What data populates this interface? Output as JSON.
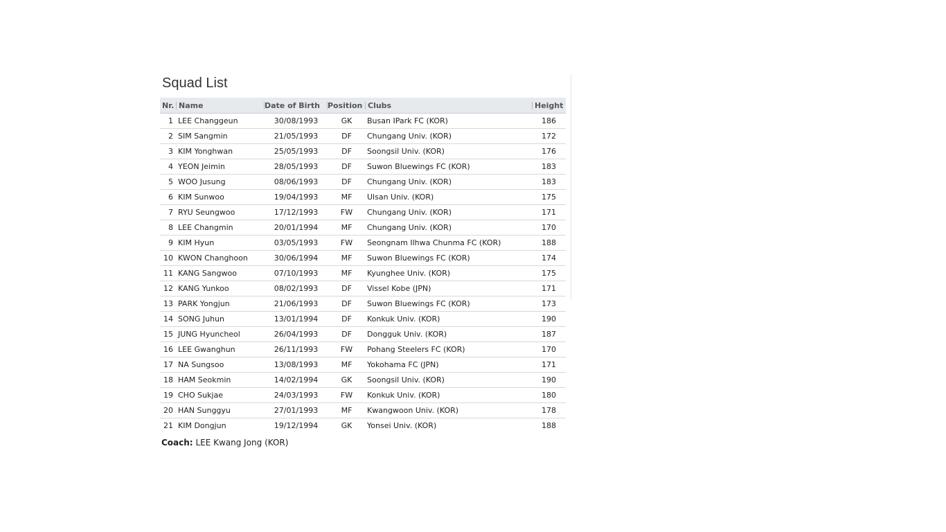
{
  "title": "Squad List",
  "columns": {
    "nr": "Nr.",
    "name": "Name",
    "dob": "Date of Birth",
    "position": "Position",
    "clubs": "Clubs",
    "height": "Height"
  },
  "players": [
    {
      "nr": "1",
      "name": "LEE Changgeun",
      "dob": "30/08/1993",
      "position": "GK",
      "club": "Busan IPark FC (KOR)",
      "height": "186"
    },
    {
      "nr": "2",
      "name": "SIM Sangmin",
      "dob": "21/05/1993",
      "position": "DF",
      "club": "Chungang Univ. (KOR)",
      "height": "172"
    },
    {
      "nr": "3",
      "name": "KIM Yonghwan",
      "dob": "25/05/1993",
      "position": "DF",
      "club": "Soongsil Univ. (KOR)",
      "height": "176"
    },
    {
      "nr": "4",
      "name": "YEON Jeimin",
      "dob": "28/05/1993",
      "position": "DF",
      "club": "Suwon Bluewings FC (KOR)",
      "height": "183"
    },
    {
      "nr": "5",
      "name": "WOO Jusung",
      "dob": "08/06/1993",
      "position": "DF",
      "club": "Chungang Univ. (KOR)",
      "height": "183"
    },
    {
      "nr": "6",
      "name": "KIM Sunwoo",
      "dob": "19/04/1993",
      "position": "MF",
      "club": "Ulsan Univ. (KOR)",
      "height": "175"
    },
    {
      "nr": "7",
      "name": "RYU Seungwoo",
      "dob": "17/12/1993",
      "position": "FW",
      "club": "Chungang Univ. (KOR)",
      "height": "171"
    },
    {
      "nr": "8",
      "name": "LEE Changmin",
      "dob": "20/01/1994",
      "position": "MF",
      "club": "Chungang Univ. (KOR)",
      "height": "170"
    },
    {
      "nr": "9",
      "name": "KIM Hyun",
      "dob": "03/05/1993",
      "position": "FW",
      "club": "Seongnam Ilhwa Chunma FC (KOR)",
      "height": "188"
    },
    {
      "nr": "10",
      "name": "KWON Changhoon",
      "dob": "30/06/1994",
      "position": "MF",
      "club": "Suwon Bluewings FC (KOR)",
      "height": "174"
    },
    {
      "nr": "11",
      "name": "KANG Sangwoo",
      "dob": "07/10/1993",
      "position": "MF",
      "club": "Kyunghee Univ. (KOR)",
      "height": "175"
    },
    {
      "nr": "12",
      "name": "KANG Yunkoo",
      "dob": "08/02/1993",
      "position": "DF",
      "club": "Vissel Kobe (JPN)",
      "height": "171"
    },
    {
      "nr": "13",
      "name": "PARK Yongjun",
      "dob": "21/06/1993",
      "position": "DF",
      "club": "Suwon Bluewings FC (KOR)",
      "height": "173"
    },
    {
      "nr": "14",
      "name": "SONG Juhun",
      "dob": "13/01/1994",
      "position": "DF",
      "club": "Konkuk Univ. (KOR)",
      "height": "190"
    },
    {
      "nr": "15",
      "name": "JUNG Hyuncheol",
      "dob": "26/04/1993",
      "position": "DF",
      "club": "Dongguk Univ. (KOR)",
      "height": "187"
    },
    {
      "nr": "16",
      "name": "LEE Gwanghun",
      "dob": "26/11/1993",
      "position": "FW",
      "club": "Pohang Steelers FC (KOR)",
      "height": "170"
    },
    {
      "nr": "17",
      "name": "NA Sungsoo",
      "dob": "13/08/1993",
      "position": "MF",
      "club": "Yokohama FC (JPN)",
      "height": "171"
    },
    {
      "nr": "18",
      "name": "HAM Seokmin",
      "dob": "14/02/1994",
      "position": "GK",
      "club": "Soongsil Univ. (KOR)",
      "height": "190"
    },
    {
      "nr": "19",
      "name": "CHO Sukjae",
      "dob": "24/03/1993",
      "position": "FW",
      "club": "Konkuk Univ. (KOR)",
      "height": "180"
    },
    {
      "nr": "20",
      "name": "HAN Sunggyu",
      "dob": "27/01/1993",
      "position": "MF",
      "club": "Kwangwoon Univ. (KOR)",
      "height": "178"
    },
    {
      "nr": "21",
      "name": "KIM Dongjun",
      "dob": "19/12/1994",
      "position": "GK",
      "club": "Yonsei Univ. (KOR)",
      "height": "188"
    }
  ],
  "coach": {
    "label": "Coach:",
    "name": "LEE Kwang Jong (KOR)"
  },
  "colors": {
    "header_bg": "#e6e9ee",
    "row_border": "#d8d8d8"
  }
}
